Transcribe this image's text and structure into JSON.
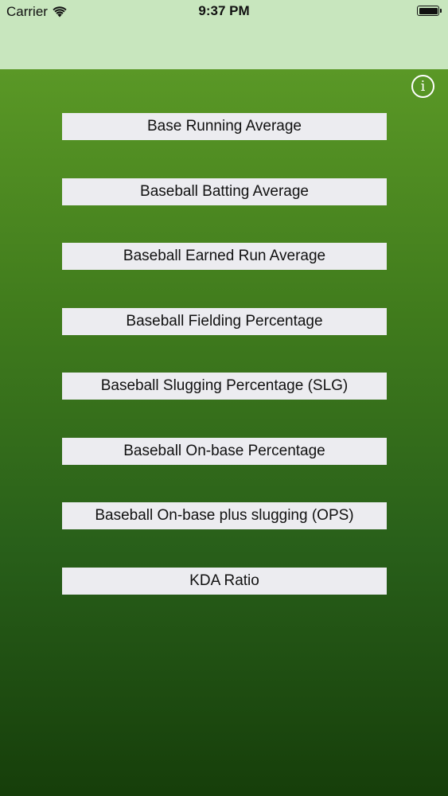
{
  "status_bar": {
    "carrier": "Carrier",
    "time": "9:37 PM",
    "wifi_icon": "wifi-icon",
    "battery_icon": "battery-icon"
  },
  "info_button": {
    "glyph": "i",
    "icon": "info-icon"
  },
  "menu": {
    "items": [
      {
        "label": "Base Running Average"
      },
      {
        "label": "Baseball Batting Average"
      },
      {
        "label": "Baseball Earned Run Average"
      },
      {
        "label": "Baseball Fielding Percentage"
      },
      {
        "label": "Baseball Slugging Percentage (SLG)"
      },
      {
        "label": "Baseball On-base Percentage"
      },
      {
        "label": "Baseball On-base plus slugging (OPS)"
      },
      {
        "label": "KDA Ratio"
      }
    ]
  },
  "colors": {
    "header_bg": "#c8e6be",
    "gradient_top": "#5a9826",
    "gradient_bottom": "#163e0a",
    "button_bg": "#ececf0"
  }
}
